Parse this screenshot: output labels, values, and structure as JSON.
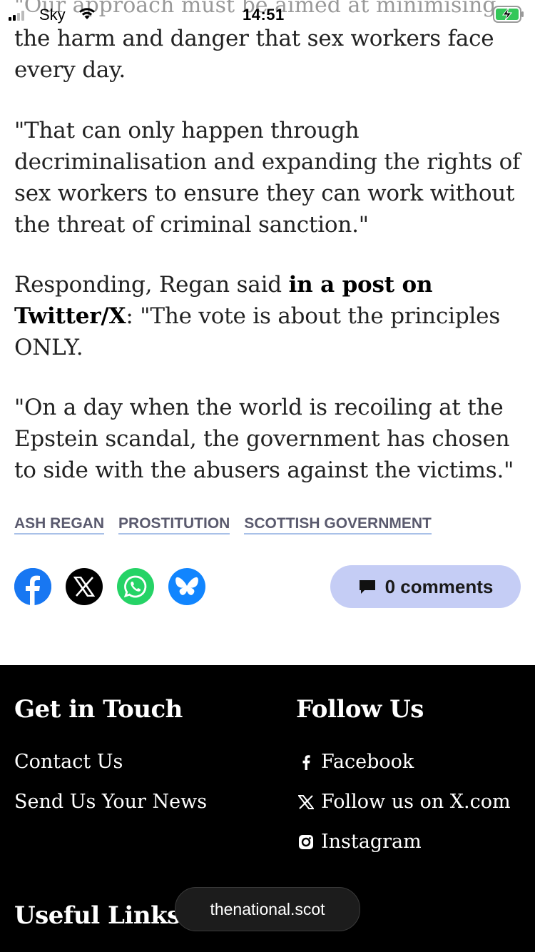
{
  "status_bar": {
    "carrier": "Sky",
    "time": "14:51",
    "signal_bars": 2,
    "charging": true
  },
  "article": {
    "cropped_line": "\"Our approach must be aimed at minimising",
    "paragraphs": [
      {
        "text": "the harm and danger that sex workers face every day."
      },
      {
        "text": "\"That can only happen through decriminalisation and expanding the rights of sex workers to ensure they can work without the threat of criminal sanction.\""
      },
      {
        "before": "Responding, Regan said ",
        "bold": "in a post on Twitter/X",
        "after": ": \"The vote is about the principles ONLY."
      },
      {
        "text": "\"On a day when the world is recoiling at the Epstein scandal, the government has chosen to side with the abusers against the victims.\""
      }
    ],
    "tags": [
      "ASH REGAN",
      "PROSTITUTION",
      "SCOTTISH GOVERNMENT"
    ],
    "share": {
      "icons": [
        "facebook-icon",
        "x-icon",
        "whatsapp-icon",
        "bluesky-icon"
      ],
      "comments_label": "0 comments"
    }
  },
  "footer": {
    "get_in_touch": {
      "title": "Get in Touch",
      "links": [
        "Contact Us",
        "Send Us Your News"
      ]
    },
    "follow_us": {
      "title": "Follow Us",
      "links": [
        {
          "icon": "facebook-f-icon",
          "label": "Facebook"
        },
        {
          "icon": "x-icon",
          "label": "Follow us on X.com"
        },
        {
          "icon": "instagram-icon",
          "label": "Instagram"
        }
      ]
    },
    "useful_links": {
      "title": "Useful Links"
    }
  },
  "browser": {
    "url": "thenational.scot"
  },
  "colors": {
    "tag_underline": "#a9c1e8",
    "comments_bg": "#c5cdf5",
    "facebook": "#1877f2",
    "whatsapp": "#25d366",
    "bluesky": "#1185fe",
    "battery_green": "#34c759"
  }
}
